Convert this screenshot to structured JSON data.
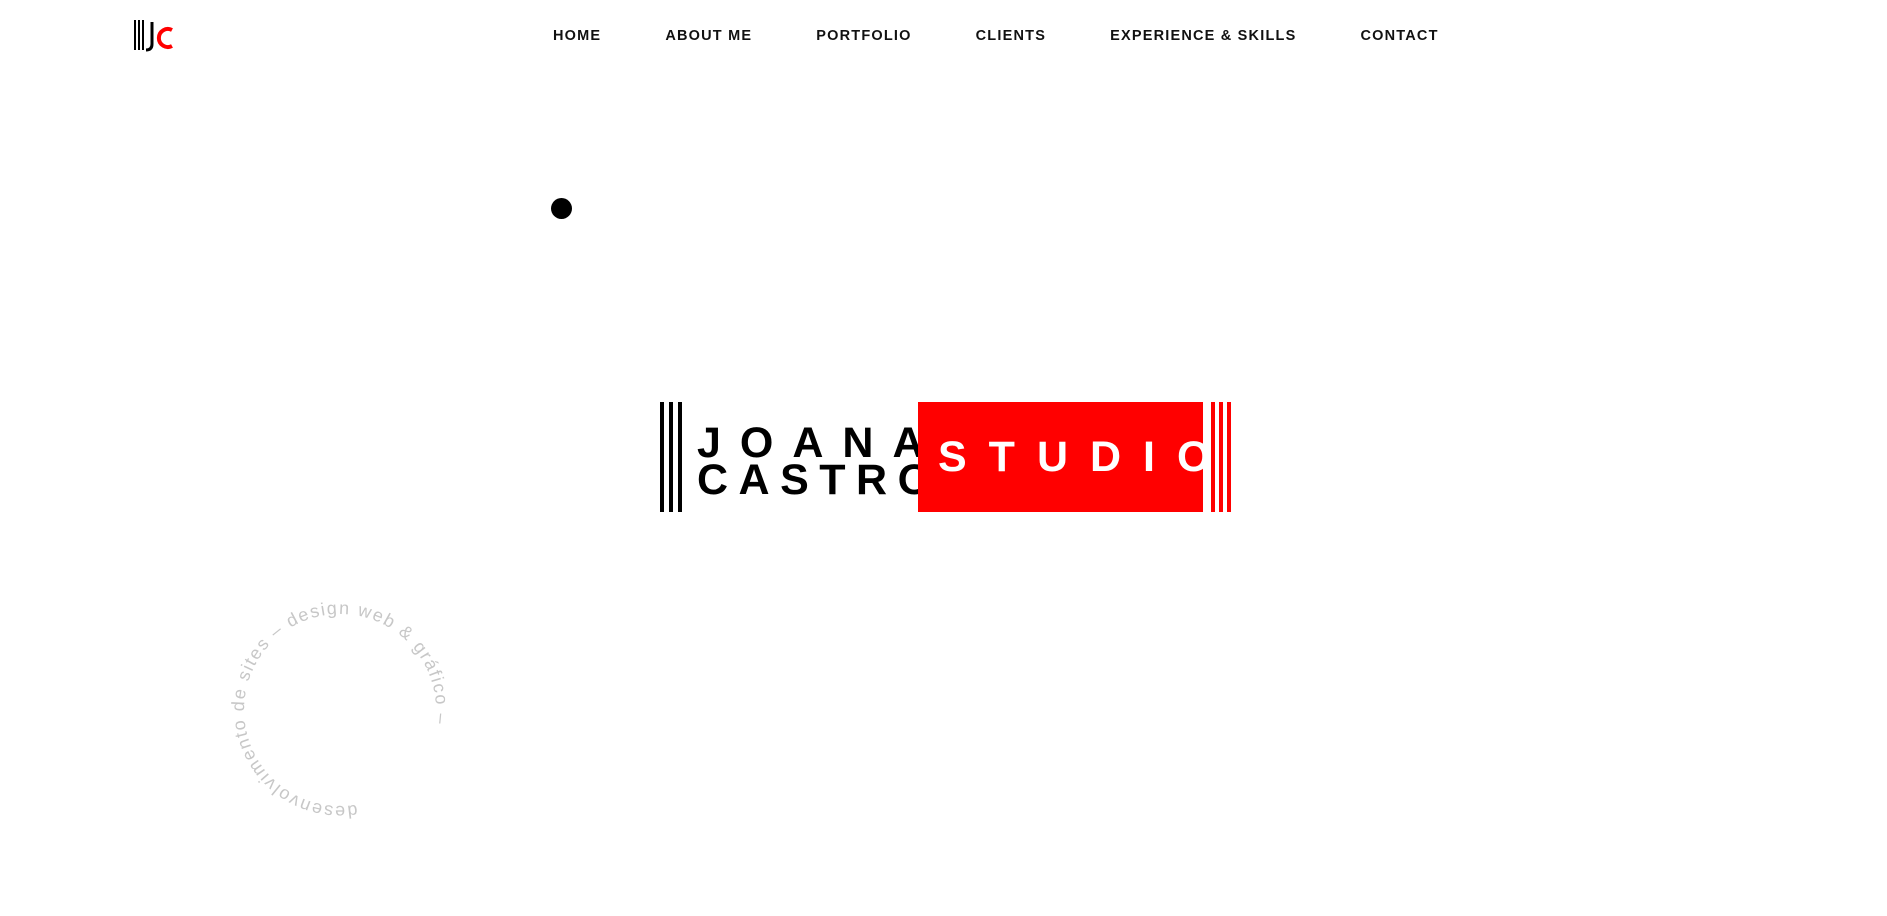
{
  "header": {
    "logo_alt": "JC",
    "nav": [
      {
        "label": "HOME"
      },
      {
        "label": "ABOUT ME"
      },
      {
        "label": "PORTFOLIO"
      },
      {
        "label": "CLIENTS"
      },
      {
        "label": "EXPERIENCE & SKILLS"
      },
      {
        "label": "CONTACT"
      }
    ]
  },
  "hero": {
    "name_first": "JOANA",
    "name_last": "CASTRO",
    "studio": "STUDIO"
  },
  "badge": {
    "text": "desenvolvimento de sites – design web & gráfico – "
  },
  "colors": {
    "brand_red": "#ff0000",
    "text_dark": "#111111",
    "badge_gray": "#c7c7c7"
  }
}
